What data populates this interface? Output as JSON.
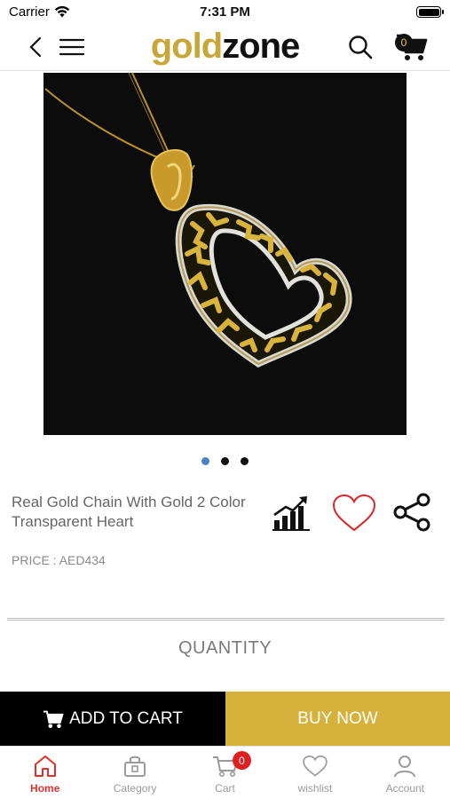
{
  "status_bar": {
    "carrier": "Carrier",
    "time": "7:31 PM"
  },
  "header": {
    "logo_part1": "gold",
    "logo_part2": "zone",
    "cart_count": "0"
  },
  "carousel": {
    "total": 3,
    "active_index": 0
  },
  "product": {
    "title": "Real Gold Chain With Gold 2 Color Transparent Heart",
    "price": "PRICE : AED434"
  },
  "quantity_label": "QUANTITY",
  "buttons": {
    "add_to_cart": "ADD TO CART",
    "buy_now": "BUY NOW"
  },
  "tabs": [
    {
      "label": "Home",
      "icon": "home-icon",
      "active": true
    },
    {
      "label": "Category",
      "icon": "category-icon",
      "active": false
    },
    {
      "label": "Cart",
      "icon": "cart-icon",
      "active": false,
      "badge": "0"
    },
    {
      "label": "wishlist",
      "icon": "heart-icon",
      "active": false
    },
    {
      "label": "Account",
      "icon": "account-icon",
      "active": false
    }
  ],
  "colors": {
    "brand_gold": "#d6b23c",
    "active_tab": "#e0302a",
    "heart_outline": "#d9262a",
    "dot_active": "#4a7fc1"
  }
}
